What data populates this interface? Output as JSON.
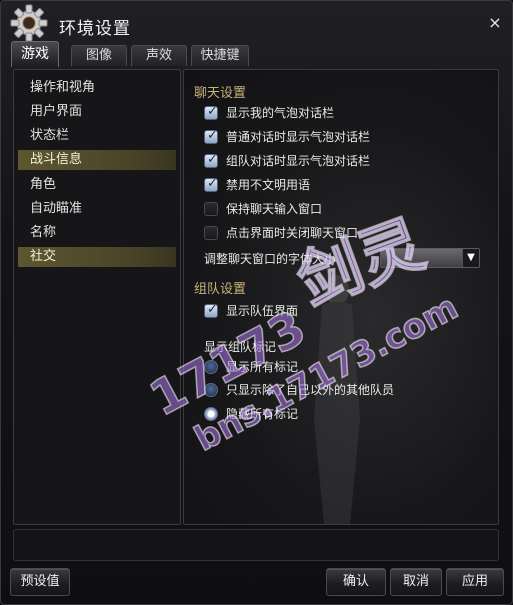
{
  "window": {
    "title": "环境设置",
    "close_icon": "×"
  },
  "tabs": [
    {
      "label": "游戏",
      "active": true
    },
    {
      "label": "图像",
      "active": false
    },
    {
      "label": "声效",
      "active": false
    },
    {
      "label": "快捷键",
      "active": false
    }
  ],
  "sidebar": {
    "items": [
      {
        "label": "操作和视角",
        "selected": false
      },
      {
        "label": "用户界面",
        "selected": false
      },
      {
        "label": "状态栏",
        "selected": false
      },
      {
        "label": "战斗信息",
        "selected": true
      },
      {
        "label": "角色",
        "selected": false
      },
      {
        "label": "自动瞄准",
        "selected": false
      },
      {
        "label": "名称",
        "selected": false
      },
      {
        "label": "社交",
        "selected": true
      }
    ]
  },
  "chat": {
    "title": "聊天设置",
    "options": [
      {
        "label": "显示我的气泡对话栏",
        "checked": true
      },
      {
        "label": "普通对话时显示气泡对话栏",
        "checked": true
      },
      {
        "label": "组队对话时显示气泡对话栏",
        "checked": true
      },
      {
        "label": "禁用不文明用语",
        "checked": true
      },
      {
        "label": "保持聊天输入窗口",
        "checked": false
      },
      {
        "label": "点击界面时关闭聊天窗口",
        "checked": false
      }
    ],
    "font_size_label": "调整聊天窗口的字体大小",
    "font_size_value": ""
  },
  "party": {
    "title": "组队设置",
    "show_party_ui": {
      "label": "显示队伍界面",
      "checked": true
    },
    "marker_title": "显示组队标记",
    "marker_options": [
      {
        "label": "显示所有标记",
        "selected": false
      },
      {
        "label": "只显示除了自己以外的其他队员",
        "selected": false
      },
      {
        "label": "隐藏所有标记",
        "selected": true
      }
    ]
  },
  "buttons": {
    "preset": "预设值",
    "confirm": "确认",
    "cancel": "取消",
    "apply": "应用"
  },
  "watermark": {
    "line1": "17173",
    "line2": "bns.17173.com",
    "logo_text": "剑灵"
  },
  "colors": {
    "section_title": "#c9b27a",
    "selected_nav": "#5e5630",
    "checkbox": "#8fa6c4"
  }
}
